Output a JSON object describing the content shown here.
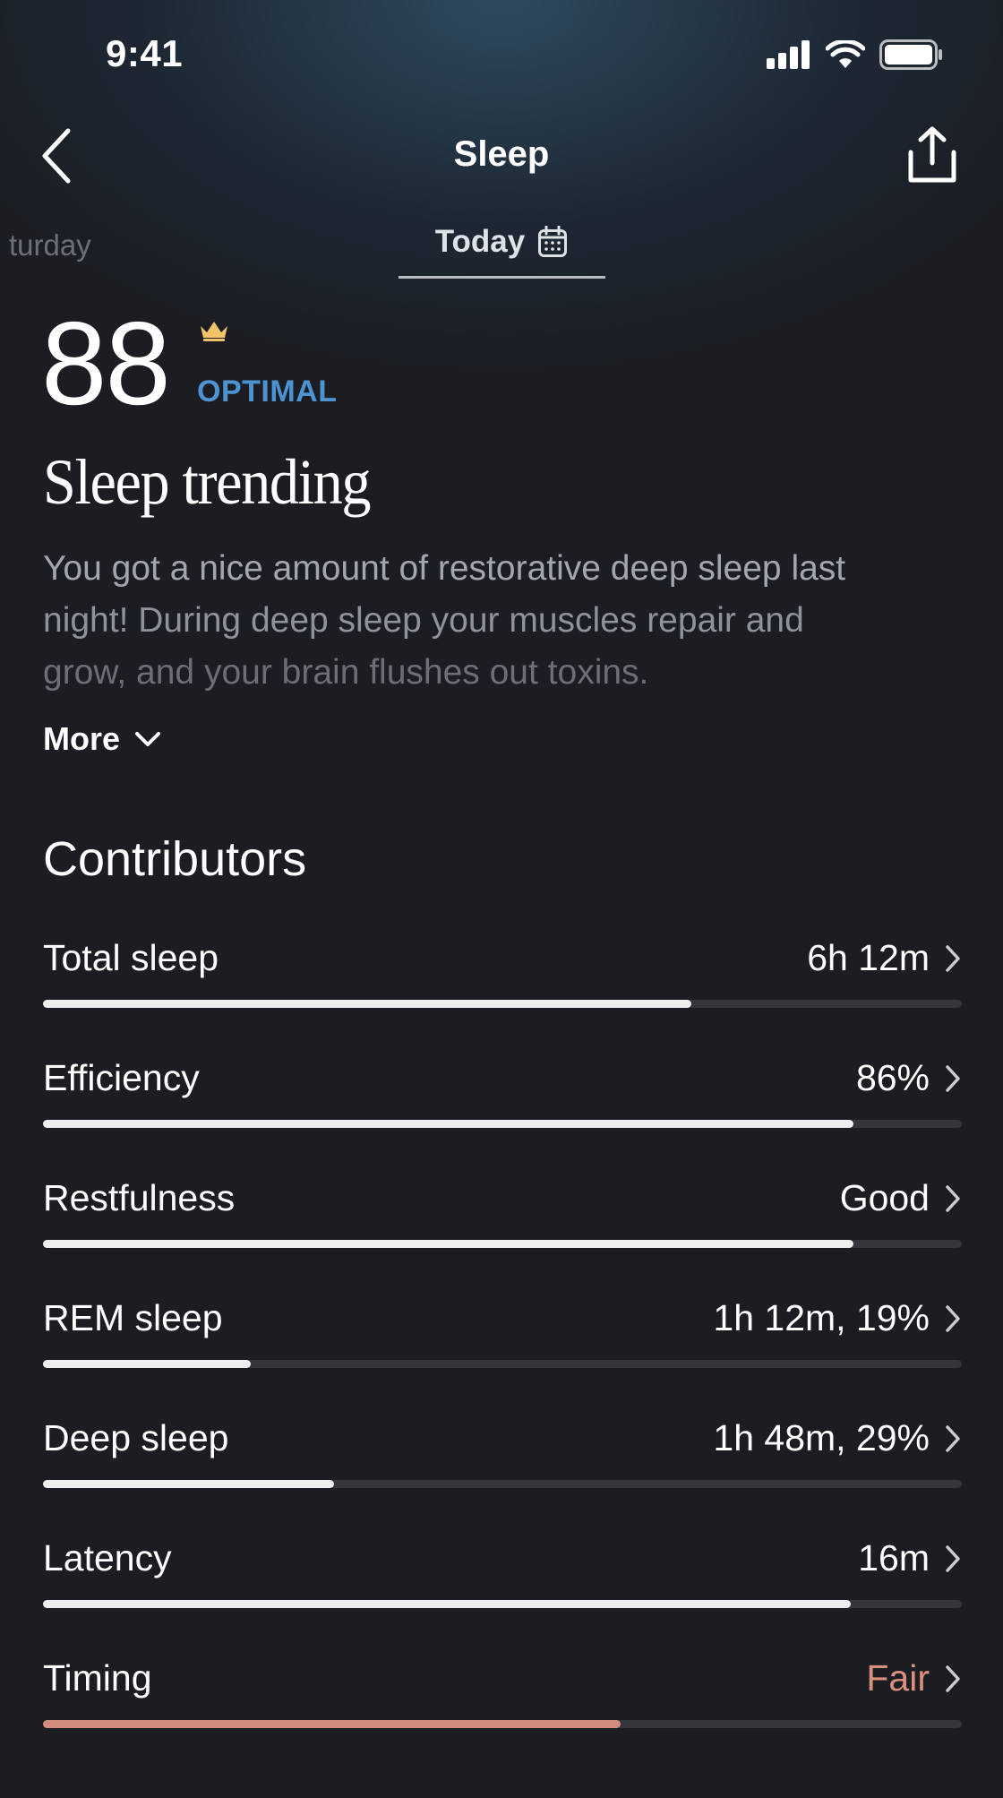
{
  "status_bar": {
    "time": "9:41"
  },
  "nav": {
    "title": "Sleep"
  },
  "date_tabs": {
    "previous": "turday",
    "current": "Today"
  },
  "score": {
    "value": "88",
    "label": "OPTIMAL",
    "label_color": "#4d93d2"
  },
  "headline": "Sleep trending",
  "body": {
    "line1": "You got a nice amount of restorative deep sleep last",
    "line2": "night! During deep sleep your muscles repair and",
    "line3": "grow, and your brain flushes out toxins."
  },
  "more_label": "More",
  "contributors": {
    "title": "Contributors",
    "items": [
      {
        "label": "Total sleep",
        "value": "6h 12m",
        "level": 0.706,
        "status": "normal"
      },
      {
        "label": "Efficiency",
        "value": "86%",
        "level": 0.882,
        "status": "normal"
      },
      {
        "label": "Restfulness",
        "value": "Good",
        "level": 0.882,
        "status": "normal"
      },
      {
        "label": "REM sleep",
        "value": "1h 12m, 19%",
        "level": 0.226,
        "status": "normal"
      },
      {
        "label": "Deep sleep",
        "value": "1h 48m, 29%",
        "level": 0.317,
        "status": "normal"
      },
      {
        "label": "Latency",
        "value": "16m",
        "level": 0.879,
        "status": "normal"
      },
      {
        "label": "Timing",
        "value": "Fair",
        "level": 0.629,
        "status": "warning"
      }
    ]
  },
  "colors": {
    "warning": "#d28d7c",
    "bar_fill": "#efefef",
    "bar_track": "#35363b"
  }
}
